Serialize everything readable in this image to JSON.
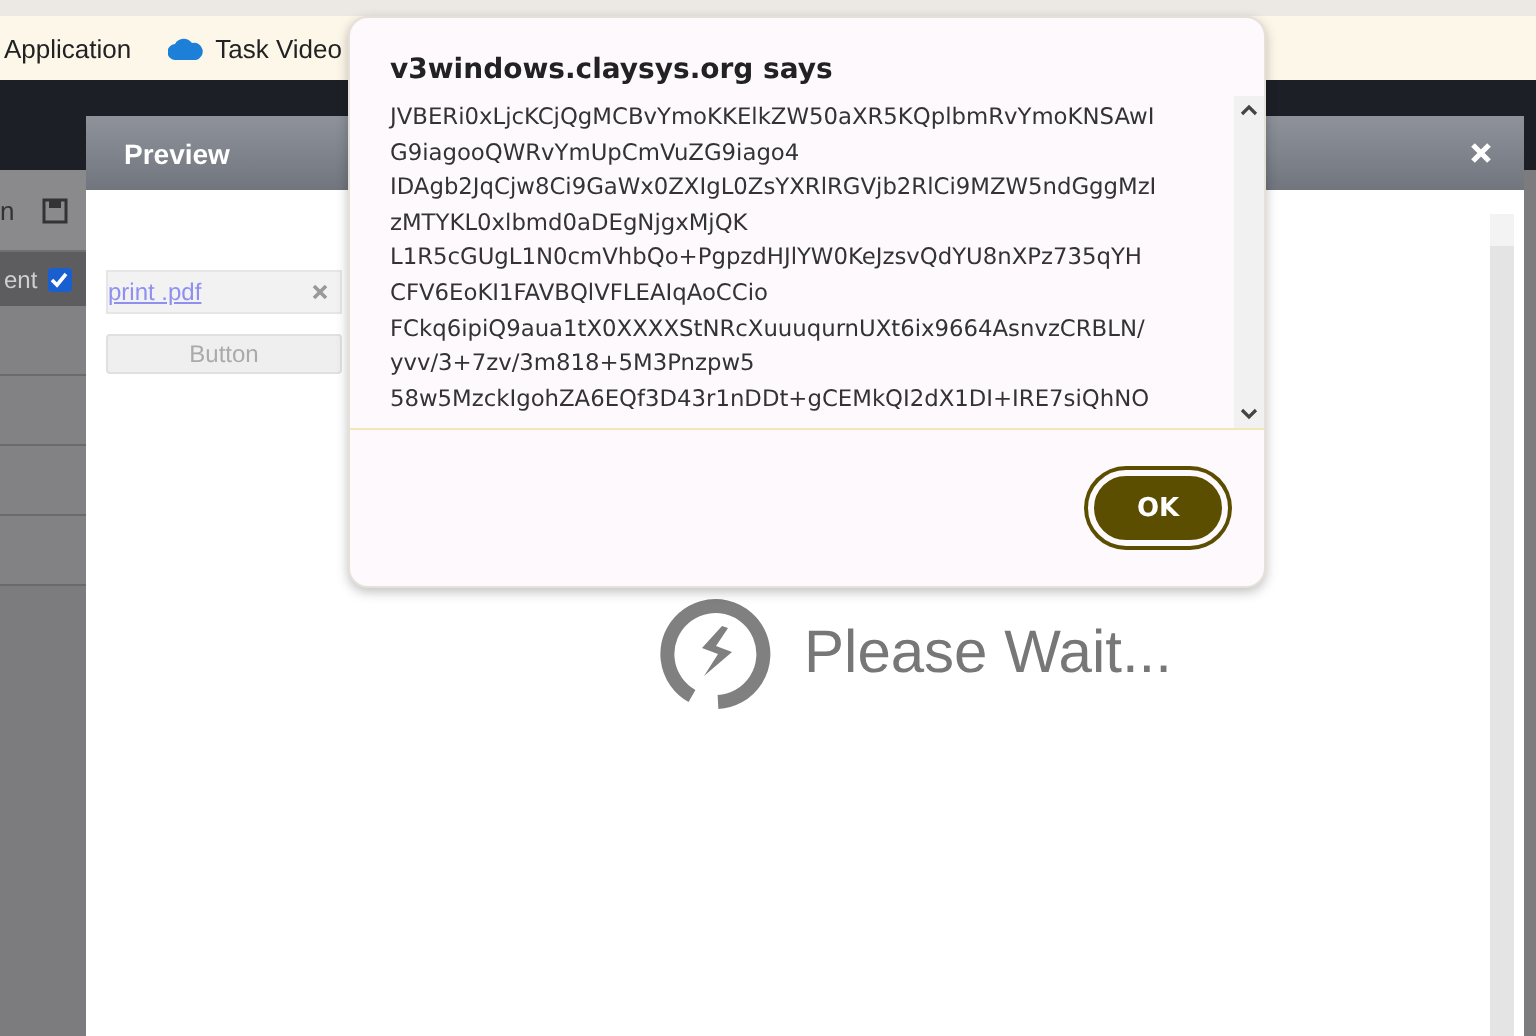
{
  "bookmarks": [
    {
      "label": "Application",
      "kind": "plain"
    },
    {
      "label": "Task Video",
      "kind": "cloud"
    }
  ],
  "background_app": {
    "toolbar_label": "n",
    "option_label": "ent",
    "option_checked": true
  },
  "preview": {
    "title": "Preview",
    "attachment": {
      "filename": "print .pdf"
    },
    "button": {
      "label": "Button",
      "disabled": true
    },
    "loading": {
      "text": "Please Wait..."
    }
  },
  "alert": {
    "title": "v3windows.claysys.org says",
    "message_lines": [
      "JVBERi0xLjcKCjQgMCBvYmoKKElkZW50aXR5KQplbmRvYmoKNSAwI",
      "G9iagooQWRvYmUpCmVuZG9iago4",
      "IDAgb2JqCjw8Ci9GaWx0ZXIgL0ZsYXRlRGVjb2RlCi9MZW5ndGggMzI",
      "zMTYKL0xlbmd0aDEgNjgxMjQK",
      "L1R5cGUgL1N0cmVhbQo+PgpzdHJlYW0KeJzsvQdYU8nXPz735qYH",
      "CFV6EoKI1FAVBQlVFLEAIqAoCCio",
      "FCkq6ipiQ9aua1tX0XXXXStNRcXuuuqurnUXt6ix9664AsnvzCRBLN/",
      "yvv/3+7zv/3m818+5M3Pnzpw5",
      "58w5MzckIgohZA6EQf3D43r1nDDt+gCEMkQI2dX1DI+IRE7siQhNO"
    ],
    "buttons": [
      {
        "label": "OK"
      }
    ]
  }
}
